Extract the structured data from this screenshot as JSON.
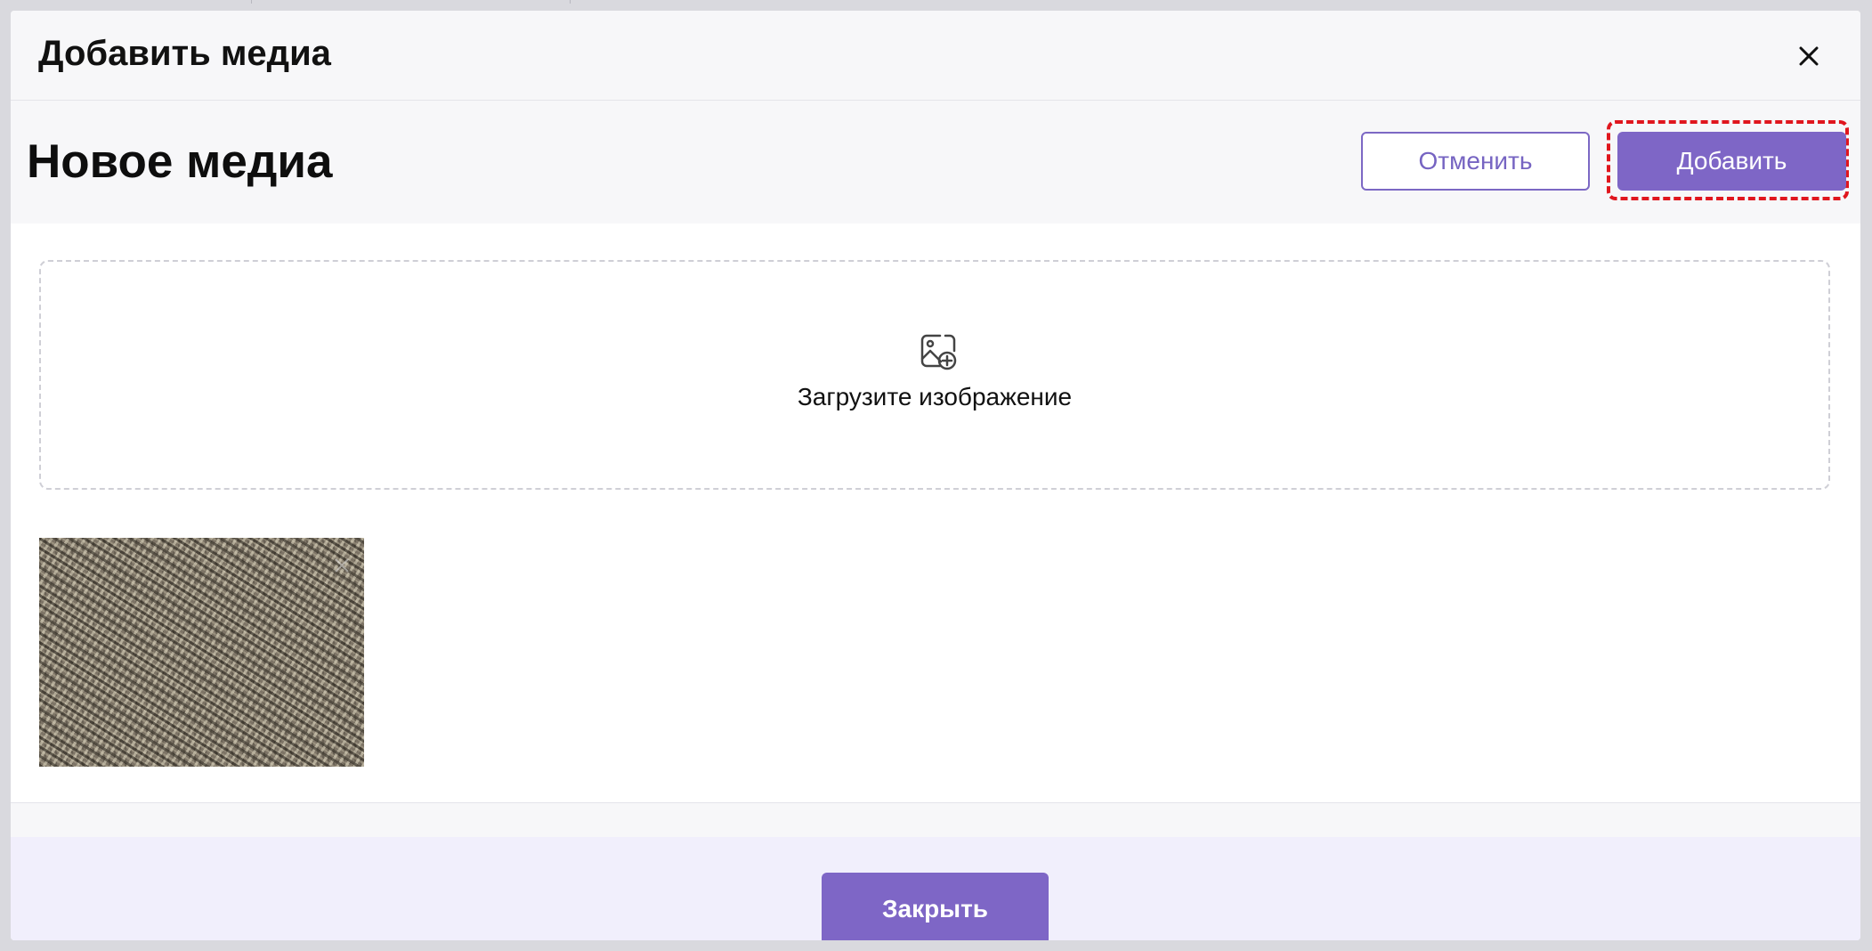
{
  "dialog": {
    "title": "Добавить медиа",
    "close_icon": "close-icon"
  },
  "toolbar": {
    "section_title": "Новое медиа",
    "cancel_label": "Отменить",
    "add_label": "Добавить"
  },
  "upload": {
    "icon": "image-add-icon",
    "label": "Загрузите изображение"
  },
  "media": {
    "thumbnail_description": "fabric texture",
    "remove_icon": "close-icon"
  },
  "footer": {
    "close_label": "Закрыть"
  },
  "colors": {
    "accent": "#7e66c6",
    "highlight": "#e0161e"
  }
}
